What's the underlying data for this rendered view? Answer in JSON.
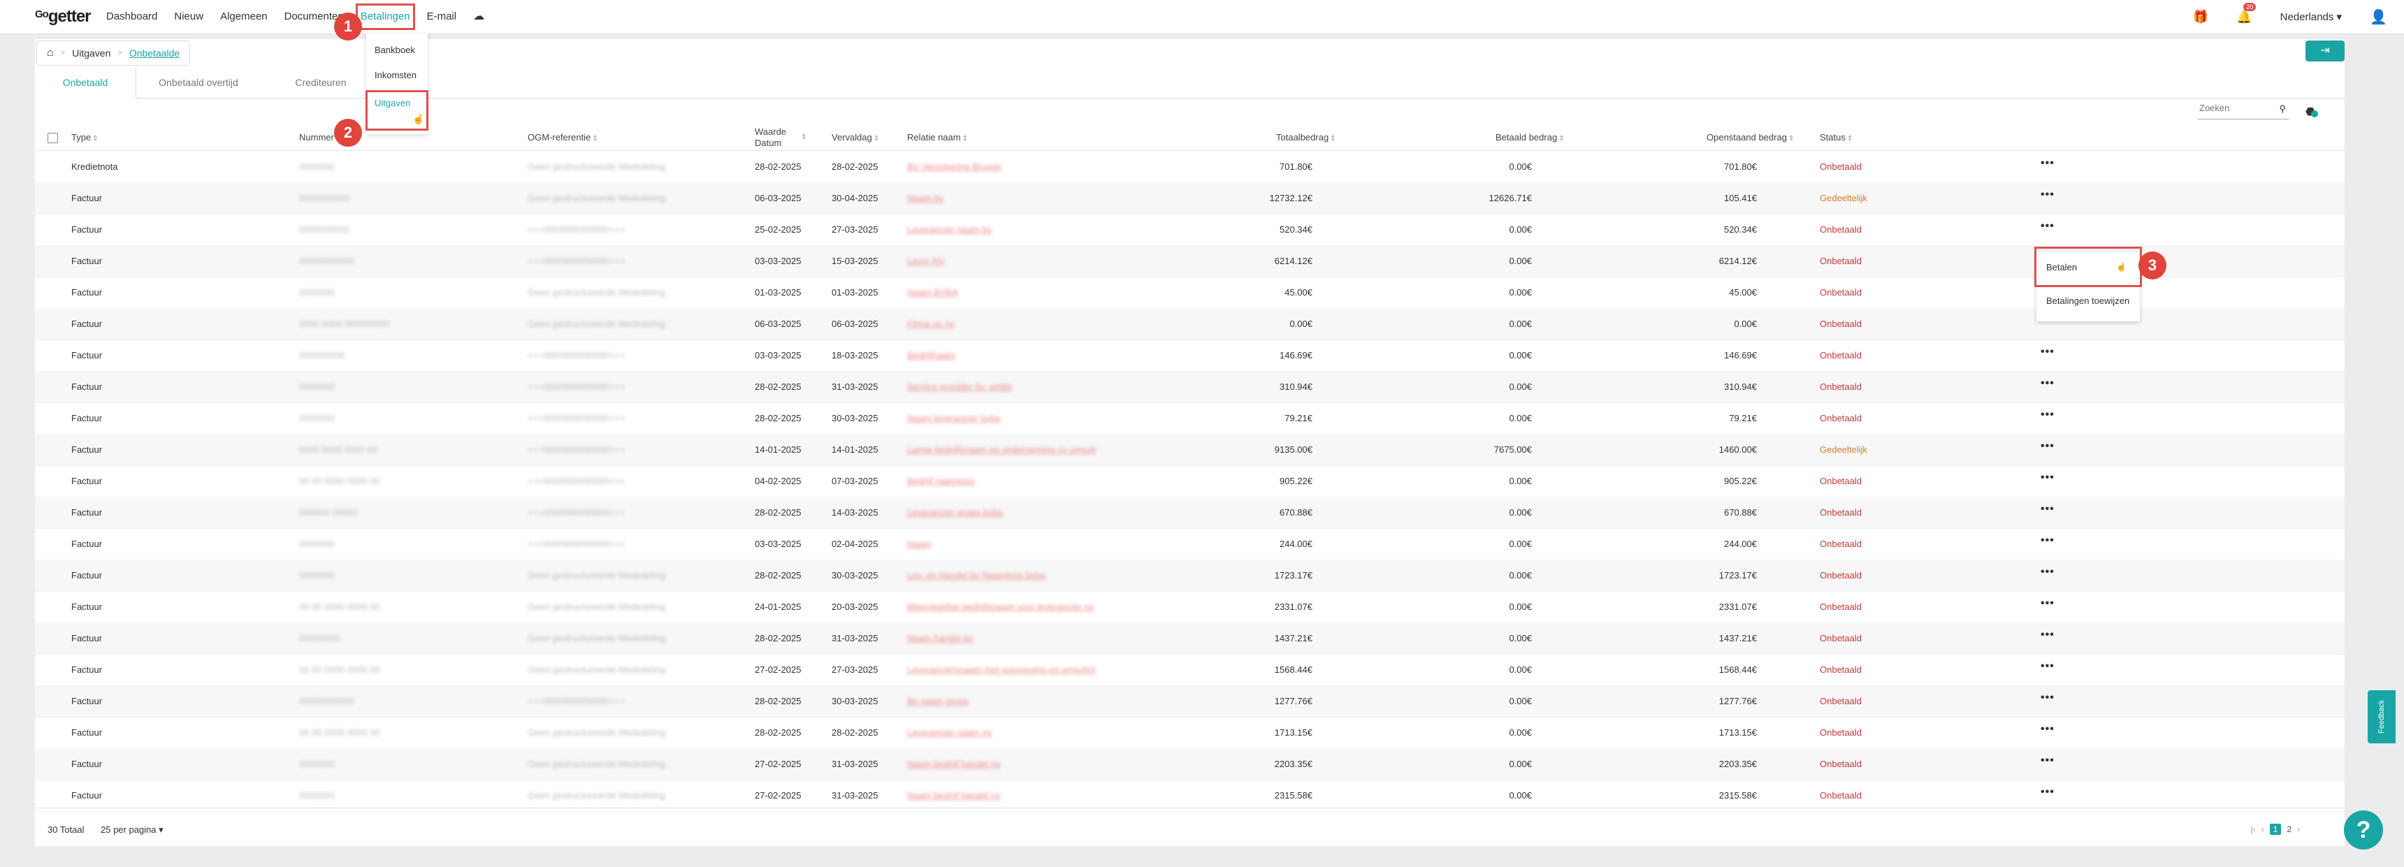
{
  "logo": {
    "go": "Go",
    "text": "getter"
  },
  "nav": [
    {
      "label": "Dashboard"
    },
    {
      "label": "Nieuw"
    },
    {
      "label": "Algemeen"
    },
    {
      "label": "Documenten"
    },
    {
      "label": "Betalingen"
    },
    {
      "label": "E-mail"
    }
  ],
  "header": {
    "language": "Nederlands",
    "notif_count": "20"
  },
  "dropdown": [
    "Bankboek",
    "Inkomsten",
    "Uitgaven"
  ],
  "callouts": [
    "1",
    "2",
    "3"
  ],
  "breadcrumb": {
    "parent": "Uitgaven",
    "current": "Onbetaalde"
  },
  "tabs": [
    "Onbetaald",
    "Onbetaald overtijd",
    "Crediteuren"
  ],
  "search": {
    "placeholder": "Zoeken"
  },
  "columns": {
    "type": "Type",
    "nummer": "Nummer",
    "ogm": "OGM-referentie",
    "waarde1": "Waarde",
    "waarde2": "Datum",
    "verval": "Vervaldag",
    "relatie": "Relatie naam",
    "totaal": "Totaalbedrag",
    "betaald": "Betaald bedrag",
    "open": "Openstaand bedrag",
    "status": "Status"
  },
  "rows": [
    {
      "type": "Kredietnota",
      "nummer": "0000000",
      "ogm": "Geen gestructureerde Mededeling",
      "waarde": "28-02-2025",
      "verval": "28-02-2025",
      "relatie": "BV Verzekering Brugge",
      "totaal": "701.80€",
      "betaald": "0.00€",
      "open": "701.80€",
      "status": "Onbetaald"
    },
    {
      "type": "Factuur",
      "nummer": "0000000000",
      "ogm": "Geen gestructureerde Mededeling",
      "waarde": "06-03-2025",
      "verval": "30-04-2025",
      "relatie": "Naam bv",
      "totaal": "12732.12€",
      "betaald": "12626.71€",
      "open": "105.41€",
      "status": "Gedeeltelijk"
    },
    {
      "type": "Factuur",
      "nummer": "0000000000",
      "ogm": "+++000/0000/00000+++",
      "waarde": "25-02-2025",
      "verval": "27-03-2025",
      "relatie": "Leverancier naam bv",
      "totaal": "520.34€",
      "betaald": "0.00€",
      "open": "520.34€",
      "status": "Onbetaald"
    },
    {
      "type": "Factuur",
      "nummer": "00000000000",
      "ogm": "+++000/0000/00000+++",
      "waarde": "03-03-2025",
      "verval": "15-03-2025",
      "relatie": "Levnr NV",
      "totaal": "6214.12€",
      "betaald": "0.00€",
      "open": "6214.12€",
      "status": "Onbetaald"
    },
    {
      "type": "Factuur",
      "nummer": "0000000",
      "ogm": "Geen gestructureerde Mededeling",
      "waarde": "01-03-2025",
      "verval": "01-03-2025",
      "relatie": "Naam BVBA",
      "totaal": "45.00€",
      "betaald": "0.00€",
      "open": "45.00€",
      "status": "Onbetaald"
    },
    {
      "type": "Factuur",
      "nummer": "0000 0000 000000000",
      "ogm": "Geen gestructureerde Mededeling",
      "waarde": "06-03-2025",
      "verval": "06-03-2025",
      "relatie": "Firma nv nv",
      "totaal": "0.00€",
      "betaald": "0.00€",
      "open": "0.00€",
      "status": "Onbetaald"
    },
    {
      "type": "Factuur",
      "nummer": "000000000",
      "ogm": "+++000/0000/00000+++",
      "waarde": "03-03-2025",
      "verval": "18-03-2025",
      "relatie": "Bedrijfnaam",
      "totaal": "146.69€",
      "betaald": "0.00€",
      "open": "146.69€",
      "status": "Onbetaald"
    },
    {
      "type": "Factuur",
      "nummer": "0000000",
      "ogm": "+++000/0000/00000+++",
      "waarde": "28-02-2025",
      "verval": "31-03-2025",
      "relatie": "Service provider bv, gmbh",
      "totaal": "310.94€",
      "betaald": "0.00€",
      "open": "310.94€",
      "status": "Onbetaald"
    },
    {
      "type": "Factuur",
      "nummer": "0000000",
      "ogm": "+++000/0000/00000+++",
      "waarde": "28-02-2025",
      "verval": "30-03-2025",
      "relatie": "Naam leverancier bvba",
      "totaal": "79.21€",
      "betaald": "0.00€",
      "open": "79.21€",
      "status": "Onbetaald"
    },
    {
      "type": "Factuur",
      "nummer": "0000 0000 0000 00",
      "ogm": "+++000/0000/00000+++",
      "waarde": "14-01-2025",
      "verval": "14-01-2025",
      "relatie": "Lange bedrijfsnaam en onderneming nv omschrijving",
      "totaal": "9135.00€",
      "betaald": "7675.00€",
      "open": "1460.00€",
      "status": "Gedeeltelijk"
    },
    {
      "type": "Factuur",
      "nummer": "00 00 0000 0000 00",
      "ogm": "+++000/0000/00000+++",
      "waarde": "04-02-2025",
      "verval": "07-03-2025",
      "relatie": "Bedrijf naamloos",
      "totaal": "905.22€",
      "betaald": "0.00€",
      "open": "905.22€",
      "status": "Onbetaald"
    },
    {
      "type": "Factuur",
      "nummer": "000000 00000",
      "ogm": "+++000/0000/00000+++",
      "waarde": "28-02-2025",
      "verval": "14-03-2025",
      "relatie": "Leverancier groep bvba",
      "totaal": "670.88€",
      "betaald": "0.00€",
      "open": "670.88€",
      "status": "Onbetaald"
    },
    {
      "type": "Factuur",
      "nummer": "0000000",
      "ogm": "+++000/0000/00000+++",
      "waarde": "03-03-2025",
      "verval": "02-04-2025",
      "relatie": "Naam",
      "totaal": "244.00€",
      "betaald": "0.00€",
      "open": "244.00€",
      "status": "Onbetaald"
    },
    {
      "type": "Factuur",
      "nummer": "0000000",
      "ogm": "Geen gestructureerde Mededeling",
      "waarde": "28-02-2025",
      "verval": "30-03-2025",
      "relatie": "Lev. en Handel bv Naamloos bvba",
      "totaal": "1723.17€",
      "betaald": "0.00€",
      "open": "1723.17€",
      "status": "Onbetaald"
    },
    {
      "type": "Factuur",
      "nummer": "00 00 0000 0000 00",
      "ogm": "Geen gestructureerde Mededeling",
      "waarde": "24-01-2025",
      "verval": "20-03-2025",
      "relatie": "Meerregelige bedrijfsnaam voor leverancier nv",
      "totaal": "2331.07€",
      "betaald": "0.00€",
      "open": "2331.07€",
      "status": "Onbetaald"
    },
    {
      "type": "Factuur",
      "nummer": "00000000",
      "ogm": "Geen gestructureerde Mededeling",
      "waarde": "28-02-2025",
      "verval": "31-03-2025",
      "relatie": "Naam handel bv",
      "totaal": "1437.21€",
      "betaald": "0.00€",
      "open": "1437.21€",
      "status": "Onbetaald"
    },
    {
      "type": "Factuur",
      "nummer": "00 00 0000 0000 00",
      "ogm": "Geen gestructureerde Mededeling",
      "waarde": "27-02-2025",
      "verval": "27-03-2025",
      "relatie": "Leveranciersnaam met toevoeging en omschrijving",
      "totaal": "1568.44€",
      "betaald": "0.00€",
      "open": "1568.44€",
      "status": "Onbetaald"
    },
    {
      "type": "Factuur",
      "nummer": "00000000000",
      "ogm": "+++000/0000/00000+++",
      "waarde": "28-02-2025",
      "verval": "30-03-2025",
      "relatie": "Bv naam groep",
      "totaal": "1277.76€",
      "betaald": "0.00€",
      "open": "1277.76€",
      "status": "Onbetaald"
    },
    {
      "type": "Factuur",
      "nummer": "00 00 0000 0000 00",
      "ogm": "Geen gestructureerde Mededeling",
      "waarde": "28-02-2025",
      "verval": "28-02-2025",
      "relatie": "Leverancier naam nv",
      "totaal": "1713.15€",
      "betaald": "0.00€",
      "open": "1713.15€",
      "status": "Onbetaald"
    },
    {
      "type": "Factuur",
      "nummer": "0000000",
      "ogm": "Geen gestructureerde Mededeling",
      "waarde": "27-02-2025",
      "verval": "31-03-2025",
      "relatie": "Naam bedrijf handel nv",
      "totaal": "2203.35€",
      "betaald": "0.00€",
      "open": "2203.35€",
      "status": "Onbetaald"
    },
    {
      "type": "Factuur",
      "nummer": "0000000",
      "ogm": "Geen gestructureerde Mededeling",
      "waarde": "27-02-2025",
      "verval": "31-03-2025",
      "relatie": "Naam bedrijf handel nv",
      "totaal": "2315.58€",
      "betaald": "0.00€",
      "open": "2315.58€",
      "status": "Onbetaald"
    }
  ],
  "popup": [
    "Betalen",
    "Betalingen toewijzen"
  ],
  "footer": {
    "total": "30 Totaal",
    "perpage": "25 per pagina",
    "pages": [
      "1",
      "2"
    ]
  },
  "feedback": "Feedback",
  "help": "?"
}
